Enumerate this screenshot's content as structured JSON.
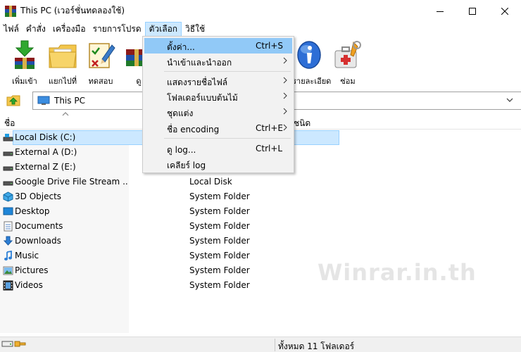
{
  "window": {
    "title": "This PC (เวอร์ชั่นทดลองใช้)",
    "minimize_icon": "minimize-icon",
    "maximize_icon": "maximize-icon",
    "close_icon": "close-icon"
  },
  "menubar": {
    "items": [
      {
        "label": "ไฟล์"
      },
      {
        "label": "คำสั่ง"
      },
      {
        "label": "เครื่องมือ"
      },
      {
        "label": "รายการโปรด"
      },
      {
        "label": "ตัวเลือก"
      },
      {
        "label": "วิธีใช้"
      }
    ],
    "active_index": 4
  },
  "toolbar": {
    "items": [
      {
        "label": "เพิ่มเข้า",
        "icon": "add-archive-icon"
      },
      {
        "label": "แยกไปที่",
        "icon": "extract-to-icon"
      },
      {
        "label": "ทดสอบ",
        "icon": "test-icon"
      },
      {
        "label": "ดู",
        "icon": "view-icon"
      },
      {
        "label": "ดูรายละเอียดต่าง ๆ",
        "icon": "info-icon"
      },
      {
        "label": "ซ่อม",
        "icon": "repair-icon"
      }
    ]
  },
  "address": {
    "path": "This PC"
  },
  "list": {
    "columns": {
      "name": "ชื่อ",
      "type": "ชนิด"
    },
    "rows": [
      {
        "name": "Local Disk (C:)",
        "type": "",
        "icon": "system-drive-icon",
        "selected": true
      },
      {
        "name": "External A (D:)",
        "type": "",
        "icon": "drive-icon",
        "selected": false
      },
      {
        "name": "External Z (E:)",
        "type": "",
        "icon": "drive-icon",
        "selected": false
      },
      {
        "name": "Google Drive File Stream ...",
        "type": "Local Disk",
        "icon": "drive-icon",
        "selected": false
      },
      {
        "name": "3D Objects",
        "type": "System Folder",
        "icon": "3d-objects-icon",
        "selected": false
      },
      {
        "name": "Desktop",
        "type": "System Folder",
        "icon": "desktop-icon",
        "selected": false
      },
      {
        "name": "Documents",
        "type": "System Folder",
        "icon": "documents-icon",
        "selected": false
      },
      {
        "name": "Downloads",
        "type": "System Folder",
        "icon": "downloads-icon",
        "selected": false
      },
      {
        "name": "Music",
        "type": "System Folder",
        "icon": "music-icon",
        "selected": false
      },
      {
        "name": "Pictures",
        "type": "System Folder",
        "icon": "pictures-icon",
        "selected": false
      },
      {
        "name": "Videos",
        "type": "System Folder",
        "icon": "videos-icon",
        "selected": false
      }
    ]
  },
  "options_menu": {
    "items": [
      {
        "label": "ตั้งค่า...",
        "shortcut": "Ctrl+S",
        "submenu": false,
        "highlighted": true
      },
      {
        "label": "นำเข้าและนำออก",
        "shortcut": "",
        "submenu": true,
        "highlighted": false
      },
      {
        "label": "แสดงรายชื่อไฟล์",
        "shortcut": "",
        "submenu": true,
        "highlighted": false
      },
      {
        "label": "โฟลเดอร์แบบต้นไม้",
        "shortcut": "",
        "submenu": true,
        "highlighted": false
      },
      {
        "label": "ชุดแต่ง",
        "shortcut": "",
        "submenu": true,
        "highlighted": false
      },
      {
        "label": "ชื่อ encoding",
        "shortcut": "Ctrl+E",
        "submenu": true,
        "highlighted": false
      },
      {
        "label": "ดู log...",
        "shortcut": "Ctrl+L",
        "submenu": false,
        "highlighted": false
      },
      {
        "label": "เคลียร์ log",
        "shortcut": "",
        "submenu": false,
        "highlighted": false
      }
    ]
  },
  "watermark": "Winrar.in.th",
  "status": {
    "text": "ทั้งหมด 11 โฟลเดอร์"
  },
  "colors": {
    "selection": "#cce8ff",
    "menu_highlight": "#91c9f7",
    "menu_background": "#f2f2f2"
  }
}
